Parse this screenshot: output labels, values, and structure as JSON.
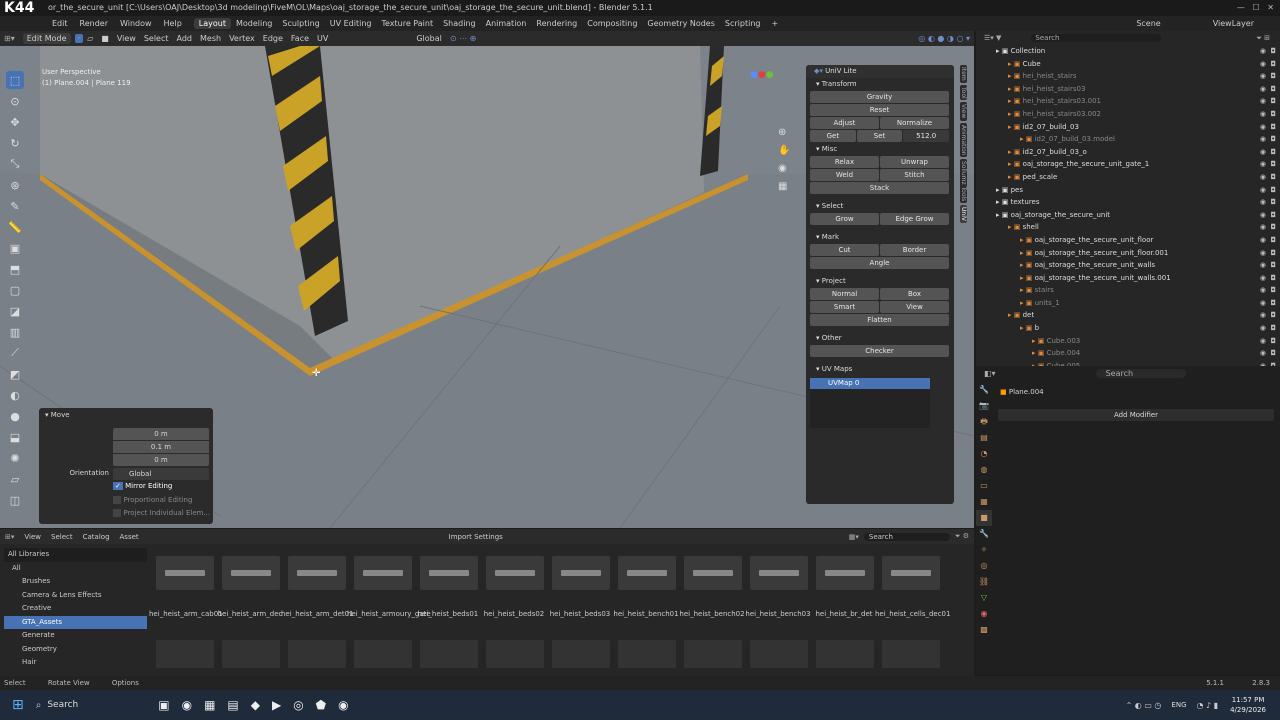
{
  "titlebar": {
    "logo": "K44",
    "text": "or_the_secure_unit [C:\\Users\\OAJ\\Desktop\\3d modeling\\FiveM\\OL\\Maps\\oaj_storage_the_secure_unit\\oaj_storage_the_secure_unit.blend] - Blender 5.1.1"
  },
  "menu": [
    "Edit",
    "Render",
    "Window",
    "Help"
  ],
  "workspaces": [
    "Layout",
    "Modeling",
    "Sculpting",
    "UV Editing",
    "Texture Paint",
    "Shading",
    "Animation",
    "Rendering",
    "Compositing",
    "Geometry Nodes",
    "Scripting"
  ],
  "active_workspace": "Layout",
  "scene_label": "Scene",
  "viewlayer_label": "ViewLayer",
  "header3d": {
    "mode": "Edit Mode",
    "menus": [
      "View",
      "Select",
      "Add",
      "Mesh",
      "Vertex",
      "Edge",
      "Face",
      "UV"
    ],
    "orientation": "Global",
    "options": "Options"
  },
  "viewport": {
    "persp": "User Perspective",
    "object": "(1) Plane.004 | Plane 119"
  },
  "npanel": {
    "title": "UniV Lite",
    "transform": {
      "label": "Transform",
      "gravity": "Gravity",
      "reset": "Reset",
      "adjust": "Adjust",
      "normalize": "Normalize",
      "get": "Get",
      "set": "Set",
      "size": "512.0"
    },
    "misc": {
      "label": "Misc",
      "relax": "Relax",
      "unwrap": "Unwrap",
      "weld": "Weld",
      "stitch": "Stitch",
      "stack": "Stack"
    },
    "select": {
      "label": "Select",
      "grow": "Grow",
      "edge_grow": "Edge Grow"
    },
    "mark": {
      "label": "Mark",
      "cut": "Cut",
      "border": "Border",
      "angle": "Angle"
    },
    "project": {
      "label": "Project",
      "normal": "Normal",
      "box": "Box",
      "smart": "Smart",
      "view": "View",
      "flatten": "Flatten"
    },
    "other": {
      "label": "Other",
      "checker": "Checker"
    },
    "uvmaps": {
      "label": "UV Maps",
      "item": "UVMap 0"
    }
  },
  "sidetabs": [
    "Item",
    "Tool",
    "View",
    "Animation",
    "Sollumz Tools",
    "UniV"
  ],
  "move": {
    "title": "Move",
    "x_label": "Move X",
    "x": "0 m",
    "y_label": "Y",
    "y": "0.1 m",
    "z_label": "Z",
    "z": "0 m",
    "orient_label": "Orientation",
    "orient": "Global",
    "mirror": "Mirror Editing",
    "prop": "Proportional Editing",
    "proj": "Project Individual Elem..."
  },
  "outliner": {
    "search": "Search",
    "rows": [
      {
        "name": "Collection",
        "level": 0,
        "dim": false
      },
      {
        "name": "Cube",
        "level": 1,
        "dim": false
      },
      {
        "name": "hei_heist_stairs",
        "level": 1,
        "dim": true
      },
      {
        "name": "hei_heist_stairs03",
        "level": 1,
        "dim": true
      },
      {
        "name": "hei_heist_stairs03.001",
        "level": 1,
        "dim": true
      },
      {
        "name": "hei_heist_stairs03.002",
        "level": 1,
        "dim": true
      },
      {
        "name": "id2_07_build_03",
        "level": 1,
        "dim": false
      },
      {
        "name": "id2_07_build_03.model",
        "level": 2,
        "dim": true
      },
      {
        "name": "id2_07_build_03_o",
        "level": 1,
        "dim": false
      },
      {
        "name": "oaj_storage_the_secure_unit_gate_1",
        "level": 1,
        "dim": false
      },
      {
        "name": "ped_scale",
        "level": 1,
        "dim": false
      },
      {
        "name": "pes",
        "level": 0,
        "dim": false
      },
      {
        "name": "textures",
        "level": 0,
        "dim": false
      },
      {
        "name": "oaj_storage_the_secure_unit",
        "level": 0,
        "dim": false
      },
      {
        "name": "shell",
        "level": 1,
        "dim": false
      },
      {
        "name": "oaj_storage_the_secure_unit_floor",
        "level": 2,
        "dim": false
      },
      {
        "name": "oaj_storage_the_secure_unit_floor.001",
        "level": 2,
        "dim": false
      },
      {
        "name": "oaj_storage_the_secure_unit_walls",
        "level": 2,
        "dim": false
      },
      {
        "name": "oaj_storage_the_secure_unit_walls.001",
        "level": 2,
        "dim": false
      },
      {
        "name": "stairs",
        "level": 2,
        "dim": true
      },
      {
        "name": "units_1",
        "level": 2,
        "dim": true
      },
      {
        "name": "det",
        "level": 1,
        "dim": false
      },
      {
        "name": "b",
        "level": 2,
        "dim": false
      },
      {
        "name": "Cube.003",
        "level": 3,
        "dim": true
      },
      {
        "name": "Cube.004",
        "level": 3,
        "dim": true
      },
      {
        "name": "Cube.005",
        "level": 3,
        "dim": true
      }
    ]
  },
  "properties": {
    "search": "Search",
    "object": "Plane.004",
    "add_modifier": "Add Modifier"
  },
  "assetbar": {
    "menus": [
      "View",
      "Select",
      "Catalog",
      "Asset"
    ],
    "import": "Import Settings",
    "search": "Search"
  },
  "libraries": {
    "selector": "All Libraries",
    "items": [
      "All",
      "Brushes",
      "Camera & Lens Effects",
      "Creative",
      "GTA_Assets",
      "Generate",
      "Geometry",
      "Hair"
    ],
    "active": "GTA_Assets"
  },
  "assets": [
    "hei_heist_arm_cab01",
    "hei_heist_arm_dec",
    "hei_heist_arm_det01",
    "hei_heist_armoury_gate",
    "hei_heist_beds01",
    "hei_heist_beds02",
    "hei_heist_beds03",
    "hei_heist_bench01",
    "hei_heist_bench02",
    "hei_heist_bench03",
    "hei_heist_br_det",
    "hei_heist_cells_dec01"
  ],
  "status": {
    "select": "Select",
    "rotate": "Rotate View",
    "options": "Options",
    "version": "5.1.1",
    "num": "2.8.3"
  },
  "taskbar": {
    "search": "Search",
    "lang": "ENG",
    "time": "11:57 PM",
    "date": "4/29/2026"
  },
  "colors": {
    "accent": "#4772b3",
    "wire": "#c8922e",
    "floor": "#7d838a"
  }
}
